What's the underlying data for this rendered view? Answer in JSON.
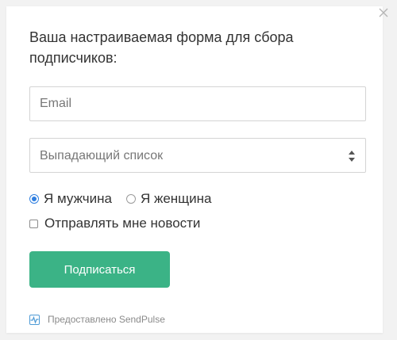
{
  "form": {
    "title": "Ваша настраиваемая форма для сбора подписчиков:",
    "email_placeholder": "Email",
    "select_value": "Выпадающий список",
    "radios": [
      {
        "label": "Я мужчина",
        "checked": true
      },
      {
        "label": "Я женщина",
        "checked": false
      }
    ],
    "checkbox_label": "Отправлять мне новости",
    "submit_label": "Подписаться",
    "footer_text": "Предоставлено SendPulse"
  },
  "icons": {
    "close": "close-icon",
    "select_arrows": "sort-arrows-icon",
    "footer": "sendpulse-logo-icon"
  },
  "colors": {
    "accent_button": "#3bb386",
    "radio_selected": "#2f7fe0",
    "logo": "#4f9bd6"
  }
}
